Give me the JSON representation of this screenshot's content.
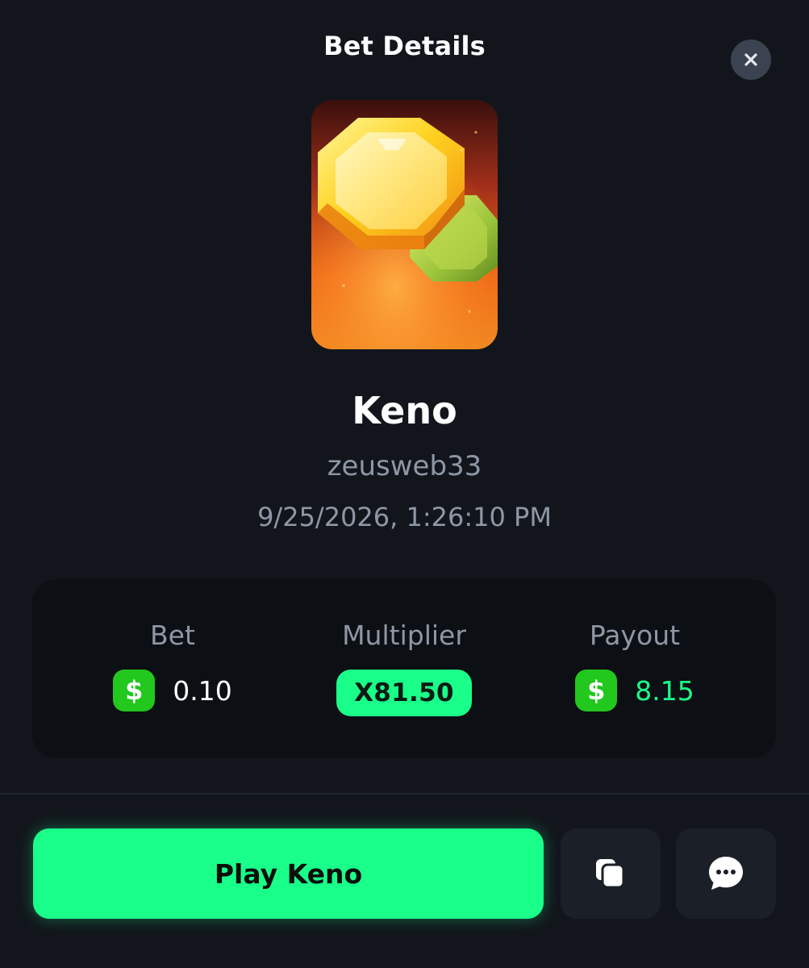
{
  "header": {
    "title": "Bet Details",
    "close_icon": "close-icon"
  },
  "game": {
    "thumbnail_icon": "keno-gem-artwork",
    "name": "Keno",
    "username": "zeusweb33",
    "timestamp": "9/25/2026, 1:26:10 PM"
  },
  "stats": {
    "bet_label": "Bet",
    "bet_currency_symbol": "$",
    "bet_amount": "0.10",
    "multiplier_label": "Multiplier",
    "multiplier_value": "X81.50",
    "payout_label": "Payout",
    "payout_currency_symbol": "$",
    "payout_amount": "8.15"
  },
  "actions": {
    "play_label": "Play Keno",
    "copy_icon": "copy-icon",
    "chat_icon": "chat-icon"
  },
  "colors": {
    "background": "#12161c",
    "card": "#0c0f13",
    "accent_green": "#19ff89",
    "currency_green": "#22c81e",
    "muted_text": "#8e97a5"
  }
}
